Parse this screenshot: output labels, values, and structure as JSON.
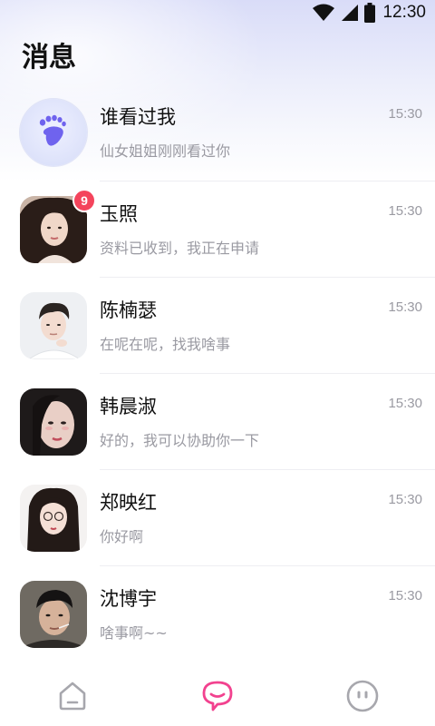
{
  "status_bar": {
    "time": "12:30",
    "icons": [
      "wifi-icon",
      "cellular-signal-icon",
      "battery-icon"
    ]
  },
  "page": {
    "title": "消息"
  },
  "conversations": [
    {
      "name": "谁看过我",
      "preview": "仙女姐姐刚刚看过你",
      "time": "15:30",
      "avatar": "footprint-icon",
      "badge": null
    },
    {
      "name": "玉照",
      "preview": "资料已收到，我正在申请",
      "time": "15:30",
      "avatar": "user-photo",
      "badge": "9"
    },
    {
      "name": "陈楠瑟",
      "preview": "在呢在呢，找我啥事",
      "time": "15:30",
      "avatar": "user-photo",
      "badge": null
    },
    {
      "name": "韩晨淑",
      "preview": "好的，我可以协助你一下",
      "time": "15:30",
      "avatar": "user-photo",
      "badge": null
    },
    {
      "name": "郑映红",
      "preview": "你好啊",
      "time": "15:30",
      "avatar": "user-photo",
      "badge": null
    },
    {
      "name": "沈博宇",
      "preview": "啥事啊~~",
      "time": "15:30",
      "avatar": "user-photo",
      "badge": null
    }
  ],
  "tabbar": {
    "tabs": [
      {
        "icon": "home-icon",
        "active": false
      },
      {
        "icon": "message-bubble-icon",
        "active": true
      },
      {
        "icon": "profile-face-icon",
        "active": false
      }
    ]
  },
  "colors": {
    "accent": "#f2428f",
    "badge": "#f4445c",
    "footprint": "#6f63ee",
    "muted_text": "#9a9aa2",
    "inactive_icon": "#a7a7ad"
  }
}
